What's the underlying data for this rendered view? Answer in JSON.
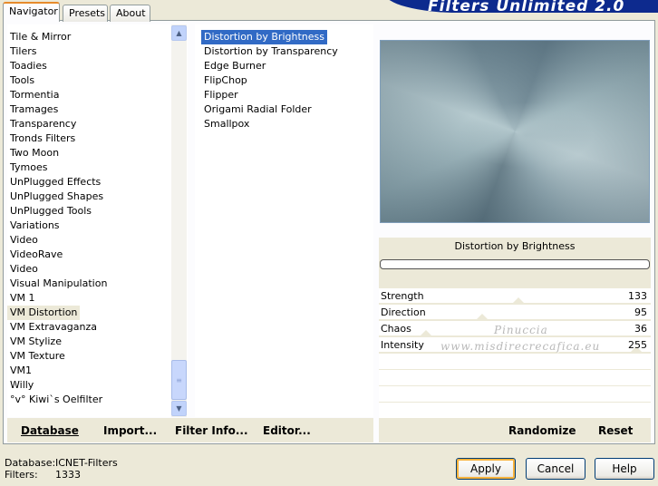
{
  "app": {
    "logo_text": "Filters Unlimited 2.0"
  },
  "tabs": [
    {
      "label": "Navigator",
      "active": true
    },
    {
      "label": "Presets",
      "active": false
    },
    {
      "label": "About",
      "active": false
    }
  ],
  "categories": {
    "items": [
      "Tile & Mirror",
      "Tilers",
      "Toadies",
      "Tools",
      "Tormentia",
      "Tramages",
      "Transparency",
      "Tronds Filters",
      "Two Moon",
      "Tymoes",
      "UnPlugged Effects",
      "UnPlugged Shapes",
      "UnPlugged Tools",
      "Variations",
      "Video",
      "VideoRave",
      "Video",
      "Visual Manipulation",
      "VM 1",
      "VM Distortion",
      "VM Extravaganza",
      "VM Stylize",
      "VM Texture",
      "VM1",
      "Willy",
      "°v° Kiwi`s Oelfilter"
    ],
    "selected": "VM Distortion"
  },
  "filters": {
    "items": [
      "Distortion by Brightness",
      "Distortion by Transparency",
      "Edge Burner",
      "FlipChop",
      "Flipper",
      "Origami Radial Folder",
      "Smallpox"
    ],
    "selected": "Distortion by Brightness"
  },
  "preview": {
    "filter_title": "Distortion by Brightness"
  },
  "sliders": [
    {
      "label": "Strength",
      "value": "133",
      "fraction": 0.52
    },
    {
      "label": "Direction",
      "value": "95",
      "fraction": 0.37
    },
    {
      "label": "Chaos",
      "value": "36",
      "fraction": 0.14
    },
    {
      "label": "Intensity",
      "value": "255",
      "fraction": 1.0
    }
  ],
  "watermark": {
    "line1": "Pinuccia",
    "line2": "www.misdirecrecafica.eu"
  },
  "left_bar": {
    "database": "Database",
    "import": "Import...",
    "filter_info": "Filter Info...",
    "editor": "Editor..."
  },
  "right_bar": {
    "randomize": "Randomize",
    "reset": "Reset"
  },
  "status": {
    "database_label": "Database:",
    "database_value": "ICNET-Filters",
    "filters_label": "Filters:",
    "filters_value": "1333"
  },
  "buttons": {
    "apply": "Apply",
    "cancel": "Cancel",
    "help": "Help"
  }
}
